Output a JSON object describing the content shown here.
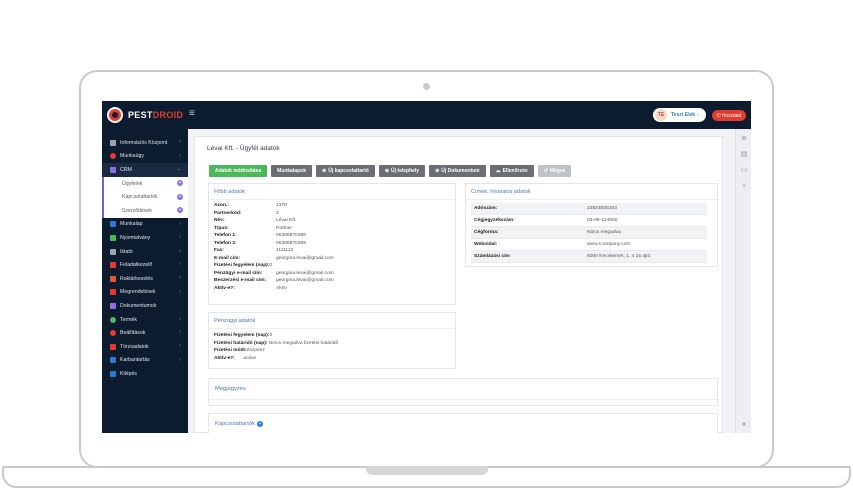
{
  "header": {
    "logo_left": "PEST",
    "logo_right": "DROID",
    "menu_toggle": "≡",
    "user_initials": "TE",
    "user_name": "Teszt Elek",
    "exit_label": "Hozzáad"
  },
  "sidebar": {
    "items": [
      {
        "label": "Információs Központ",
        "icon_color": "#9aa3b1",
        "icon": "home-icon"
      },
      {
        "label": "Munkaügy",
        "icon_color": "#e33b2f",
        "icon": "clock-icon"
      },
      {
        "label": "CRM",
        "icon_color": "#8f6ee6",
        "icon": "users-icon"
      },
      {
        "label": "Munkalap",
        "icon_color": "#2a7ad0",
        "icon": "clipboard-icon"
      },
      {
        "label": "Nyomtatvány",
        "icon_color": "#4cb85c",
        "icon": "printer-icon"
      },
      {
        "label": "Iktató",
        "icon_color": "#9aa3b1",
        "icon": "archive-icon"
      },
      {
        "label": "Feladatkezelő",
        "icon_color": "#e33b2f",
        "icon": "calendar-icon"
      },
      {
        "label": "Raktárkezelés",
        "icon_color": "#e35a2f",
        "icon": "box-icon"
      },
      {
        "label": "Megrendelések",
        "icon_color": "#e33b2f",
        "icon": "cart-icon"
      },
      {
        "label": "Dokumentumok",
        "icon_color": "#8f6ee6",
        "icon": "file-icon"
      },
      {
        "label": "Termék",
        "icon_color": "#4cb85c",
        "icon": "tag-icon"
      },
      {
        "label": "Beállítások",
        "icon_color": "#e33b2f",
        "icon": "gear-icon"
      },
      {
        "label": "Törzsadatok",
        "icon_color": "#e33b2f",
        "icon": "database-icon"
      },
      {
        "label": "Karbantartás",
        "icon_color": "#2a7ad0",
        "icon": "wrench-icon"
      },
      {
        "label": "Kilépés",
        "icon_color": "#2a7ad0",
        "icon": "logout-icon"
      }
    ],
    "crm_sub": [
      "Ügyfelek",
      "Kapcsolattartók",
      "Szerződések"
    ]
  },
  "page": {
    "title": "Lévai Kft. - Ügyfél adatok"
  },
  "toolbar": {
    "edit": "Adatok módosítása",
    "worksheets": "Munkalapok",
    "new_contact": "Új kapcsolattartó",
    "new_site": "Új telephely",
    "new_document": "Új Dokumentum",
    "check": "Ellenőrzés",
    "back": "Mégse"
  },
  "main_data": {
    "title": "Főbb adatok",
    "rows": [
      {
        "k": "Azon.:",
        "v": "1370"
      },
      {
        "k": "Partnerkód:",
        "v": "2"
      },
      {
        "k": "Név:",
        "v": "Lévai Kft."
      },
      {
        "k": "Típus:",
        "v": "Partner"
      },
      {
        "k": "Telefon 1:",
        "v": "06306970386"
      },
      {
        "k": "Telefon 2:",
        "v": "06306970389"
      },
      {
        "k": "Fax:",
        "v": "1111112"
      },
      {
        "k": "E-mail cím:",
        "v": "georgina.levai@gmail.com"
      },
      {
        "k": "Fizetési fegyelem (nap):",
        "v": "0"
      },
      {
        "k": "Pénzügyi e-mail cím:",
        "v": "georgina.levai@gmail.com"
      },
      {
        "k": "Beszerzési e-mail cím:",
        "v": "georgina.levai@gmail.com"
      },
      {
        "k": "Aktív-e?:",
        "v": "Aktív"
      }
    ]
  },
  "addresses": {
    "title": "Címek, hivatalos adatok",
    "rows": [
      {
        "k": "Adószám:",
        "v": "23923555203"
      },
      {
        "k": "Cégjegyzékszám:",
        "v": "03-09-124560"
      },
      {
        "k": "Cégforma:",
        "v": "Nincs megadva"
      },
      {
        "k": "Weboldal:",
        "v": "www.rcompany.com"
      },
      {
        "k": "Számlázási cím",
        "v": "6000 Kecskemét, 1. 4 15 ajtó"
      }
    ]
  },
  "finance": {
    "title": "Pénzügyi adatok",
    "rows": [
      {
        "k": "Fizetési fegyelem (nap):",
        "v": "0"
      },
      {
        "k": "Fizetési határidő (nap):",
        "v": "Nincs megadva fizetési határidő"
      },
      {
        "k": "Fizetési mód:",
        "v": "Készpénz"
      },
      {
        "k": "Aktív-e?:",
        "v": "active"
      }
    ]
  },
  "notes": {
    "title": "Megjegyzés"
  },
  "contacts": {
    "title": "Kapcsolattartók",
    "add": "+"
  },
  "rail": {
    "collapse": "«"
  }
}
